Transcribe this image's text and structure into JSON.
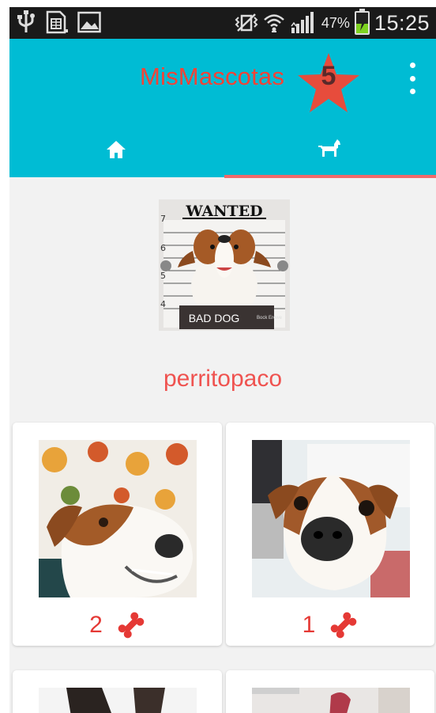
{
  "status_bar": {
    "battery_percent": "47%",
    "battery_level": 0.47,
    "time": "15:25",
    "icons": [
      "usb-icon",
      "sim-card-icon",
      "image-icon",
      "vibrate-icon",
      "wifi-icon",
      "signal-icon",
      "battery-charging-icon"
    ]
  },
  "app_bar": {
    "title": "MisMascotas",
    "star_count": "5",
    "overflow_icon": "more-vert-icon",
    "background_color": "#00bcd4",
    "title_color": "#f44336",
    "star_color": "#e74c3c"
  },
  "tabs": [
    {
      "name": "home",
      "icon": "home-icon",
      "selected": false
    },
    {
      "name": "pets",
      "icon": "dog-icon",
      "selected": true
    }
  ],
  "profile": {
    "name": "perritopaco",
    "image": {
      "heading": "WANTED",
      "sign": "BAD DOG",
      "fine_print": "Bock Erowe",
      "height_marks": [
        "7",
        "6",
        "5",
        "4"
      ]
    }
  },
  "pet_cards": [
    {
      "likes": "2",
      "like_icon": "bone-icon"
    },
    {
      "likes": "1",
      "like_icon": "bone-icon"
    }
  ],
  "accent_color": "#e53935"
}
